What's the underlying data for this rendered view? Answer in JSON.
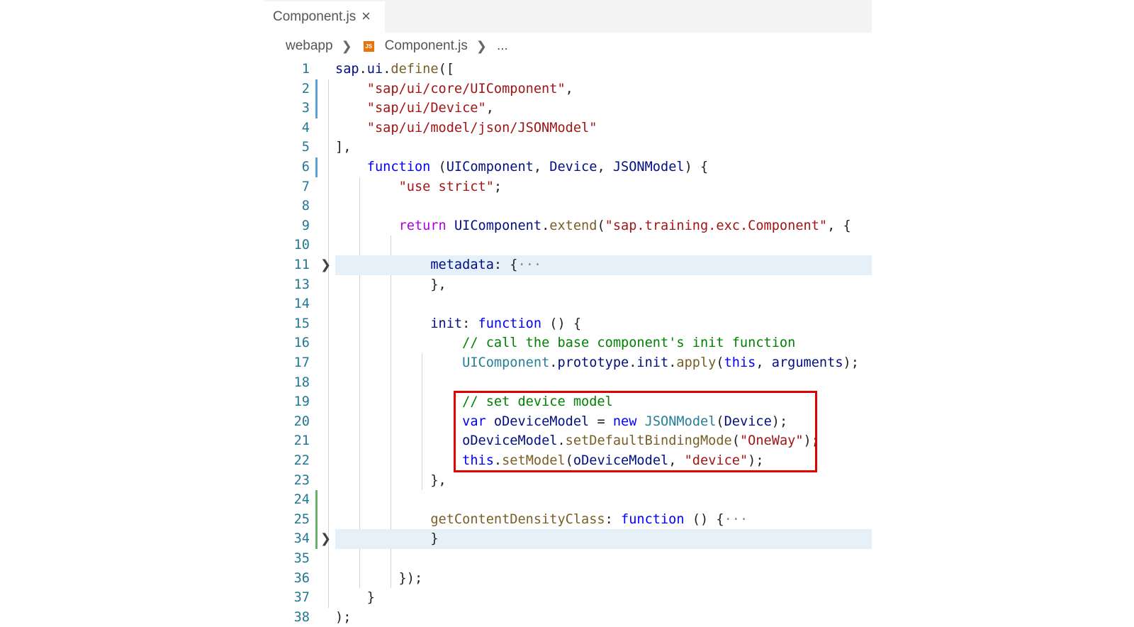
{
  "tab": {
    "label": "Component.js",
    "close_glyph": "×"
  },
  "breadcrumb": {
    "folder": "webapp",
    "file": "Component.js",
    "more": "...",
    "file_icon": "js-file-icon"
  },
  "colors": {
    "highlight_box": "#e00000",
    "line_numbers": "#237893"
  },
  "lines": [
    {
      "n": "1",
      "tokens": [
        [
          "t-prop",
          "sap"
        ],
        [
          "t-default",
          "."
        ],
        [
          "t-prop",
          "ui"
        ],
        [
          "t-default",
          "."
        ],
        [
          "t-fn",
          "define"
        ],
        [
          "t-default",
          "(["
        ]
      ]
    },
    {
      "n": "2",
      "tokens": [
        [
          "t-default",
          "    "
        ],
        [
          "t-str",
          "\"sap/ui/core/UIComponent\""
        ],
        [
          "t-default",
          ","
        ]
      ]
    },
    {
      "n": "3",
      "tokens": [
        [
          "t-default",
          "    "
        ],
        [
          "t-str",
          "\"sap/ui/Device\""
        ],
        [
          "t-default",
          ","
        ]
      ]
    },
    {
      "n": "4",
      "tokens": [
        [
          "t-default",
          "    "
        ],
        [
          "t-str",
          "\"sap/ui/model/json/JSONModel\""
        ]
      ]
    },
    {
      "n": "5",
      "tokens": [
        [
          "t-default",
          "],"
        ]
      ]
    },
    {
      "n": "6",
      "tokens": [
        [
          "t-default",
          "    "
        ],
        [
          "t-kw",
          "function"
        ],
        [
          "t-default",
          " ("
        ],
        [
          "t-prop",
          "UIComponent"
        ],
        [
          "t-default",
          ", "
        ],
        [
          "t-prop",
          "Device"
        ],
        [
          "t-default",
          ", "
        ],
        [
          "t-prop",
          "JSONModel"
        ],
        [
          "t-default",
          ") {"
        ]
      ]
    },
    {
      "n": "7",
      "tokens": [
        [
          "t-default",
          "        "
        ],
        [
          "t-str",
          "\"use strict\""
        ],
        [
          "t-default",
          ";"
        ]
      ]
    },
    {
      "n": "8",
      "tokens": []
    },
    {
      "n": "9",
      "tokens": [
        [
          "t-default",
          "        "
        ],
        [
          "t-ctl",
          "return"
        ],
        [
          "t-default",
          " "
        ],
        [
          "t-prop",
          "UIComponent"
        ],
        [
          "t-default",
          "."
        ],
        [
          "t-fn",
          "extend"
        ],
        [
          "t-default",
          "("
        ],
        [
          "t-str",
          "\"sap.training.exc.Component\""
        ],
        [
          "t-default",
          ", {"
        ]
      ]
    },
    {
      "n": "10",
      "tokens": []
    },
    {
      "n": "11",
      "tokens": [
        [
          "t-default",
          "            "
        ],
        [
          "t-prop",
          "metadata"
        ],
        [
          "t-default",
          ": {"
        ],
        [
          "t-ell",
          "···"
        ]
      ]
    },
    {
      "n": "13",
      "tokens": [
        [
          "t-default",
          "            },"
        ]
      ]
    },
    {
      "n": "14",
      "tokens": []
    },
    {
      "n": "15",
      "tokens": [
        [
          "t-default",
          "            "
        ],
        [
          "t-prop",
          "init"
        ],
        [
          "t-default",
          ": "
        ],
        [
          "t-kw",
          "function"
        ],
        [
          "t-default",
          " () {"
        ]
      ]
    },
    {
      "n": "16",
      "tokens": [
        [
          "t-default",
          "                "
        ],
        [
          "t-cmt",
          "// call the base component's init function"
        ]
      ]
    },
    {
      "n": "17",
      "tokens": [
        [
          "t-default",
          "                "
        ],
        [
          "t-type",
          "UIComponent"
        ],
        [
          "t-default",
          "."
        ],
        [
          "t-prop",
          "prototype"
        ],
        [
          "t-default",
          "."
        ],
        [
          "t-prop",
          "init"
        ],
        [
          "t-default",
          "."
        ],
        [
          "t-fn",
          "apply"
        ],
        [
          "t-default",
          "("
        ],
        [
          "t-kw",
          "this"
        ],
        [
          "t-default",
          ", "
        ],
        [
          "t-prop",
          "arguments"
        ],
        [
          "t-default",
          ");"
        ]
      ]
    },
    {
      "n": "18",
      "tokens": []
    },
    {
      "n": "19",
      "tokens": [
        [
          "t-default",
          "                "
        ],
        [
          "t-cmt",
          "// set device model"
        ]
      ]
    },
    {
      "n": "20",
      "tokens": [
        [
          "t-default",
          "                "
        ],
        [
          "t-kw",
          "var"
        ],
        [
          "t-default",
          " "
        ],
        [
          "t-prop",
          "oDeviceModel"
        ],
        [
          "t-default",
          " = "
        ],
        [
          "t-kw",
          "new"
        ],
        [
          "t-default",
          " "
        ],
        [
          "t-type",
          "JSONModel"
        ],
        [
          "t-default",
          "("
        ],
        [
          "t-prop",
          "Device"
        ],
        [
          "t-default",
          ");"
        ]
      ]
    },
    {
      "n": "21",
      "tokens": [
        [
          "t-default",
          "                "
        ],
        [
          "t-prop",
          "oDeviceModel"
        ],
        [
          "t-default",
          "."
        ],
        [
          "t-fn",
          "setDefaultBindingMode"
        ],
        [
          "t-default",
          "("
        ],
        [
          "t-str",
          "\"OneWay\""
        ],
        [
          "t-default",
          ");"
        ]
      ]
    },
    {
      "n": "22",
      "tokens": [
        [
          "t-default",
          "                "
        ],
        [
          "t-kw",
          "this"
        ],
        [
          "t-default",
          "."
        ],
        [
          "t-fn",
          "setModel"
        ],
        [
          "t-default",
          "("
        ],
        [
          "t-prop",
          "oDeviceModel"
        ],
        [
          "t-default",
          ", "
        ],
        [
          "t-str",
          "\"device\""
        ],
        [
          "t-default",
          ");"
        ]
      ]
    },
    {
      "n": "23",
      "tokens": [
        [
          "t-default",
          "            },"
        ]
      ]
    },
    {
      "n": "24",
      "tokens": []
    },
    {
      "n": "25",
      "tokens": [
        [
          "t-default",
          "            "
        ],
        [
          "t-fn",
          "getContentDensityClass"
        ],
        [
          "t-default",
          ": "
        ],
        [
          "t-kw",
          "function"
        ],
        [
          "t-default",
          " () {"
        ],
        [
          "t-ell",
          "···"
        ]
      ]
    },
    {
      "n": "34",
      "tokens": [
        [
          "t-default",
          "            }"
        ]
      ]
    },
    {
      "n": "35",
      "tokens": []
    },
    {
      "n": "36",
      "tokens": [
        [
          "t-default",
          "        });"
        ]
      ]
    },
    {
      "n": "37",
      "tokens": [
        [
          "t-default",
          "    }"
        ]
      ]
    },
    {
      "n": "38",
      "tokens": [
        [
          "t-default",
          ");"
        ]
      ]
    }
  ]
}
